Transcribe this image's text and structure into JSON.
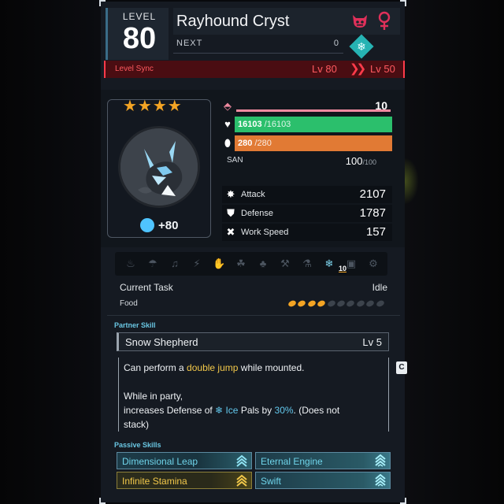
{
  "header": {
    "level_label": "LEVEL",
    "level": "80",
    "pal_name": "Rayhound Cryst",
    "next_label": "NEXT",
    "next_value": "0",
    "element_icon": "ice-icon",
    "gender": "female",
    "boss_icon": "boss-icon"
  },
  "level_sync": {
    "label": "Level Sync",
    "from": "Lv 80",
    "to": "Lv 50",
    "color": "#ff3b4a"
  },
  "portrait": {
    "stars": "★★★★",
    "souls": "+80"
  },
  "stats": {
    "trust": "10",
    "hp": "16103",
    "hp_max": "/16103",
    "stomach": "280",
    "stomach_max": "/280",
    "san_label": "SAN",
    "san": "100",
    "san_max": "/100",
    "attack_label": "Attack",
    "attack": "2107",
    "defense_label": "Defense",
    "defense": "1787",
    "work_speed_label": "Work Speed",
    "work_speed": "157"
  },
  "work": {
    "active_level": "10",
    "current_task_label": "Current Task",
    "current_task": "Idle",
    "food_label": "Food",
    "food_filled": 4,
    "food_total": 10
  },
  "partner_skill": {
    "section_title": "Partner Skill",
    "name": "Snow Shepherd",
    "level": "Lv 5",
    "desc_1": "Can perform a ",
    "desc_1_hl": "double jump",
    "desc_1_end": " while mounted.",
    "desc_2": "While in party,",
    "desc_3": "increases Defense of ",
    "desc_3_icon": "❄",
    "desc_3_hl": "Ice",
    "desc_3_mid": " Pals by ",
    "desc_3_pct": "30%",
    "desc_3_end": ".  (Does not",
    "desc_4": "stack)",
    "side_tab": "C"
  },
  "passive_skills": {
    "section_title": "Passive Skills",
    "items": [
      {
        "name": "Dimensional Leap"
      },
      {
        "name": "Eternal Engine"
      },
      {
        "name": "Infinite Stamina"
      },
      {
        "name": "Swift"
      }
    ]
  }
}
